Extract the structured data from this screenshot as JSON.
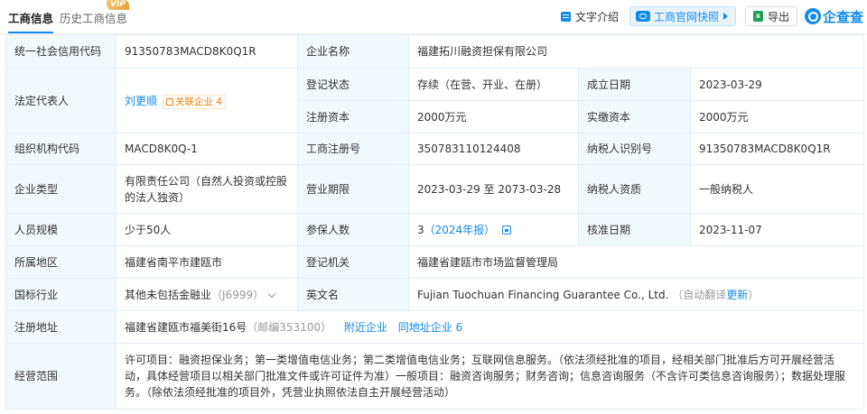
{
  "tabs": {
    "business_info": "工商信息",
    "history": "历史工商信息",
    "vip_badge": "VIP"
  },
  "toolbar": {
    "text_intro": "文字介绍",
    "official_snapshot": "工商官网快照",
    "export": "导出",
    "logo_text": "企查查"
  },
  "company": {
    "credit_code_label": "统一社会信用代码",
    "credit_code": "91350783MACD8K0Q1R",
    "name_label": "企业名称",
    "name": "福建拓川融资担保有限公司",
    "legal_rep_label": "法定代表人",
    "legal_rep": "刘更顺",
    "related_label": "关联企业",
    "related_count": "4",
    "reg_status_label": "登记状态",
    "reg_status": "存续（在营、开业、在册）",
    "founded_label": "成立日期",
    "founded": "2023-03-29",
    "reg_capital_label": "注册资本",
    "reg_capital": "2000万元",
    "paid_capital_label": "实缴资本",
    "paid_capital": "2000万元",
    "org_code_label": "组织机构代码",
    "org_code": "MACD8K0Q-1",
    "biz_reg_no_label": "工商注册号",
    "biz_reg_no": "350783110124408",
    "taxpayer_id_label": "纳税人识别号",
    "taxpayer_id": "91350783MACD8K0Q1R",
    "type_label": "企业类型",
    "type": "有限责任公司（自然人投资或控股的法人独资）",
    "term_label": "营业期限",
    "term": "2023-03-29 至 2073-03-28",
    "taxpayer_qual_label": "纳税人资质",
    "taxpayer_qual": "一般纳税人",
    "staff_label": "人员规模",
    "staff": "少于50人",
    "insured_label": "参保人数",
    "insured": "3",
    "insured_report": "（2024年报）",
    "check_date_label": "核准日期",
    "check_date": "2023-11-07",
    "region_label": "所属地区",
    "region": "福建省南平市建瓯市",
    "authority_label": "登记机关",
    "authority": "福建省建瓯市市场监督管理局",
    "industry_label": "国标行业",
    "industry": "其他未包括金融业",
    "industry_code": "（J6999）",
    "en_name_label": "英文名",
    "en_name": "Fujian Tuochuan Financing Guarantee Co., Ltd.",
    "auto_translate": "（自动翻译",
    "update_link": "更新",
    "auto_translate_end": "）",
    "address_label": "注册地址",
    "address": "福建省建瓯市福美街16号",
    "postcode": "（邮编353100）",
    "nearby_link": "附近企业",
    "same_addr_link": "同地址企业",
    "same_addr_count": "6",
    "scope_label": "经营范围",
    "scope": "许可项目：融资担保业务；第一类增值电信业务；第二类增值电信业务；互联网信息服务。（依法须经批准的项目，经相关部门批准后方可开展经营活动，具体经营项目以相关部门批准文件或许可证件为准）一般项目：融资咨询服务；财务咨询；信息咨询服务（不含许可类信息咨询服务）；数据处理服务。（除依法须经批准的项目外，凭营业执照依法自主开展经营活动）"
  }
}
